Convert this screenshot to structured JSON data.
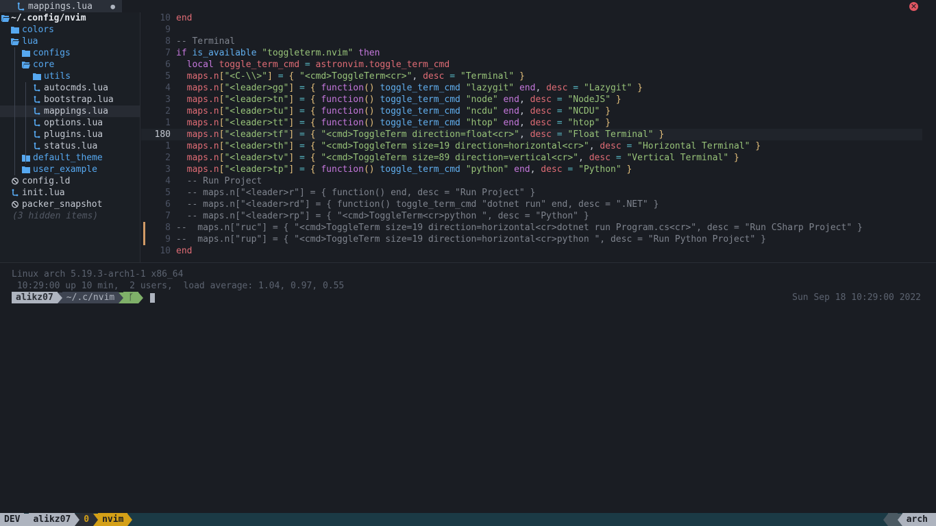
{
  "tabbar": {
    "active_tab": "mappings.lua",
    "modified_indicator": "●",
    "close_glyph": "✕",
    "close_color": "#e05561"
  },
  "tree": {
    "root": "~/.config/nvim",
    "items": [
      {
        "label": "colors",
        "type": "dir",
        "icon": "folder-icon"
      },
      {
        "label": "lua",
        "type": "dir",
        "icon": "folder-open-icon"
      },
      {
        "label": "configs",
        "type": "dir",
        "icon": "folder-icon"
      },
      {
        "label": "core",
        "type": "dir",
        "icon": "folder-open-icon"
      },
      {
        "label": "utils",
        "type": "dir",
        "icon": "folder-icon"
      },
      {
        "label": "autocmds.lua",
        "type": "file",
        "icon": "lua-file-icon"
      },
      {
        "label": "bootstrap.lua",
        "type": "file",
        "icon": "lua-file-icon"
      },
      {
        "label": "mappings.lua",
        "type": "file",
        "icon": "lua-file-icon",
        "selected": true
      },
      {
        "label": "options.lua",
        "type": "file",
        "icon": "lua-file-icon"
      },
      {
        "label": "plugins.lua",
        "type": "file",
        "icon": "lua-file-icon"
      },
      {
        "label": "status.lua",
        "type": "file",
        "icon": "lua-file-icon"
      },
      {
        "label": "default_theme",
        "type": "dir",
        "icon": "folder-icon"
      },
      {
        "label": "user_example",
        "type": "dir",
        "icon": "folder-icon"
      },
      {
        "label": "config.ld",
        "type": "file",
        "icon": "blocked-file-icon"
      },
      {
        "label": "init.lua",
        "type": "file",
        "icon": "lua-file-icon"
      },
      {
        "label": "packer_snapshot",
        "type": "file",
        "icon": "blocked-file-icon"
      }
    ],
    "hidden_items": "(3 hidden items)"
  },
  "editor": {
    "lines": [
      {
        "n": "10",
        "segs": [
          [
            "kw2",
            "end"
          ]
        ]
      },
      {
        "n": "9",
        "segs": []
      },
      {
        "n": "8",
        "segs": [
          [
            "cm",
            "-- Terminal"
          ]
        ]
      },
      {
        "n": "7",
        "segs": [
          [
            "kw",
            "if "
          ],
          [
            "fn",
            "is_available "
          ],
          [
            "str",
            "\"toggleterm.nvim\""
          ],
          [
            "kw",
            " then"
          ]
        ]
      },
      {
        "n": "6",
        "segs": [
          [
            "pl",
            "  "
          ],
          [
            "kw",
            "local "
          ],
          [
            "var",
            "toggle_term_cmd "
          ],
          [
            "op",
            "= "
          ],
          [
            "var",
            "astronvim.toggle_term_cmd"
          ]
        ]
      },
      {
        "n": "5",
        "segs": [
          [
            "pl",
            "  "
          ],
          [
            "var",
            "maps.n"
          ],
          [
            "br",
            "["
          ],
          [
            "str",
            "\"<C-\\\\>\""
          ],
          [
            "br",
            "]"
          ],
          [
            "op",
            " = "
          ],
          [
            "br",
            "{ "
          ],
          [
            "str",
            "\"<cmd>ToggleTerm<cr>\""
          ],
          [
            "pl",
            ", "
          ],
          [
            "var",
            "desc "
          ],
          [
            "op",
            "= "
          ],
          [
            "str",
            "\"Terminal\""
          ],
          [
            "br",
            " }"
          ]
        ]
      },
      {
        "n": "4",
        "segs": [
          [
            "pl",
            "  "
          ],
          [
            "var",
            "maps.n"
          ],
          [
            "br",
            "["
          ],
          [
            "str",
            "\"<leader>gg\""
          ],
          [
            "br",
            "]"
          ],
          [
            "op",
            " = "
          ],
          [
            "br",
            "{ "
          ],
          [
            "kw",
            "function"
          ],
          [
            "br",
            "()"
          ],
          [
            "fn",
            " toggle_term_cmd "
          ],
          [
            "str",
            "\"lazygit\""
          ],
          [
            "kw",
            " end"
          ],
          [
            "pl",
            ", "
          ],
          [
            "var",
            "desc "
          ],
          [
            "op",
            "= "
          ],
          [
            "str",
            "\"Lazygit\""
          ],
          [
            "br",
            " }"
          ]
        ]
      },
      {
        "n": "3",
        "segs": [
          [
            "pl",
            "  "
          ],
          [
            "var",
            "maps.n"
          ],
          [
            "br",
            "["
          ],
          [
            "str",
            "\"<leader>tn\""
          ],
          [
            "br",
            "]"
          ],
          [
            "op",
            " = "
          ],
          [
            "br",
            "{ "
          ],
          [
            "kw",
            "function"
          ],
          [
            "br",
            "()"
          ],
          [
            "fn",
            " toggle_term_cmd "
          ],
          [
            "str",
            "\"node\""
          ],
          [
            "kw",
            " end"
          ],
          [
            "pl",
            ", "
          ],
          [
            "var",
            "desc "
          ],
          [
            "op",
            "= "
          ],
          [
            "str",
            "\"NodeJS\""
          ],
          [
            "br",
            " }"
          ]
        ]
      },
      {
        "n": "2",
        "segs": [
          [
            "pl",
            "  "
          ],
          [
            "var",
            "maps.n"
          ],
          [
            "br",
            "["
          ],
          [
            "str",
            "\"<leader>tu\""
          ],
          [
            "br",
            "]"
          ],
          [
            "op",
            " = "
          ],
          [
            "br",
            "{ "
          ],
          [
            "kw",
            "function"
          ],
          [
            "br",
            "()"
          ],
          [
            "fn",
            " toggle_term_cmd "
          ],
          [
            "str",
            "\"ncdu\""
          ],
          [
            "kw",
            " end"
          ],
          [
            "pl",
            ", "
          ],
          [
            "var",
            "desc "
          ],
          [
            "op",
            "= "
          ],
          [
            "str",
            "\"NCDU\""
          ],
          [
            "br",
            " }"
          ]
        ]
      },
      {
        "n": "1",
        "segs": [
          [
            "pl",
            "  "
          ],
          [
            "var",
            "maps.n"
          ],
          [
            "br",
            "["
          ],
          [
            "str",
            "\"<leader>tt\""
          ],
          [
            "br",
            "]"
          ],
          [
            "op",
            " = "
          ],
          [
            "br",
            "{ "
          ],
          [
            "kw",
            "function"
          ],
          [
            "br",
            "()"
          ],
          [
            "fn",
            " toggle_term_cmd "
          ],
          [
            "str",
            "\"htop\""
          ],
          [
            "kw",
            " end"
          ],
          [
            "pl",
            ", "
          ],
          [
            "var",
            "desc "
          ],
          [
            "op",
            "= "
          ],
          [
            "str",
            "\"htop\""
          ],
          [
            "br",
            " }"
          ]
        ]
      },
      {
        "n": "180",
        "current": true,
        "segs": [
          [
            "pl",
            "  "
          ],
          [
            "var",
            "maps.n"
          ],
          [
            "br",
            "["
          ],
          [
            "str",
            "\"<leader>tf\""
          ],
          [
            "br",
            "]"
          ],
          [
            "op",
            " = "
          ],
          [
            "br",
            "{ "
          ],
          [
            "str",
            "\"<cmd>ToggleTerm direction=float<cr>\""
          ],
          [
            "pl",
            ", "
          ],
          [
            "var",
            "desc "
          ],
          [
            "op",
            "= "
          ],
          [
            "str",
            "\"Float Terminal\""
          ],
          [
            "br",
            " }"
          ]
        ]
      },
      {
        "n": "1",
        "segs": [
          [
            "pl",
            "  "
          ],
          [
            "var",
            "maps.n"
          ],
          [
            "br",
            "["
          ],
          [
            "str",
            "\"<leader>th\""
          ],
          [
            "br",
            "]"
          ],
          [
            "op",
            " = "
          ],
          [
            "br",
            "{ "
          ],
          [
            "str",
            "\"<cmd>ToggleTerm size=19 direction=horizontal<cr>\""
          ],
          [
            "pl",
            ", "
          ],
          [
            "var",
            "desc "
          ],
          [
            "op",
            "= "
          ],
          [
            "str",
            "\"Horizontal Terminal\""
          ],
          [
            "br",
            " }"
          ]
        ]
      },
      {
        "n": "2",
        "segs": [
          [
            "pl",
            "  "
          ],
          [
            "var",
            "maps.n"
          ],
          [
            "br",
            "["
          ],
          [
            "str",
            "\"<leader>tv\""
          ],
          [
            "br",
            "]"
          ],
          [
            "op",
            " = "
          ],
          [
            "br",
            "{ "
          ],
          [
            "str",
            "\"<cmd>ToggleTerm size=89 direction=vertical<cr>\""
          ],
          [
            "pl",
            ", "
          ],
          [
            "var",
            "desc "
          ],
          [
            "op",
            "= "
          ],
          [
            "str",
            "\"Vertical Terminal\""
          ],
          [
            "br",
            " }"
          ]
        ]
      },
      {
        "n": "3",
        "segs": [
          [
            "pl",
            "  "
          ],
          [
            "var",
            "maps.n"
          ],
          [
            "br",
            "["
          ],
          [
            "str",
            "\"<leader>tp\""
          ],
          [
            "br",
            "]"
          ],
          [
            "op",
            " = "
          ],
          [
            "br",
            "{ "
          ],
          [
            "kw",
            "function"
          ],
          [
            "br",
            "()"
          ],
          [
            "fn",
            " toggle_term_cmd "
          ],
          [
            "str",
            "\"python\""
          ],
          [
            "kw",
            " end"
          ],
          [
            "pl",
            ", "
          ],
          [
            "var",
            "desc "
          ],
          [
            "op",
            "= "
          ],
          [
            "str",
            "\"Python\""
          ],
          [
            "br",
            " }"
          ]
        ]
      },
      {
        "n": "4",
        "segs": [
          [
            "cm",
            "  -- Run Project"
          ]
        ]
      },
      {
        "n": "5",
        "segs": [
          [
            "cm",
            "  -- maps.n[\"<leader>r\"] = { function() end, desc = \"Run Project\" }"
          ]
        ]
      },
      {
        "n": "6",
        "segs": [
          [
            "cm",
            "  -- maps.n[\"<leader>rd\"] = { function() toggle_term_cmd \"dotnet run\" end, desc = \".NET\" }"
          ]
        ]
      },
      {
        "n": "7",
        "segs": [
          [
            "cm",
            "  -- maps.n[\"<leader>rp\"] = { \"<cmd>ToggleTerm<cr>python \", desc = \"Python\" }"
          ]
        ]
      },
      {
        "n": "8",
        "mark": true,
        "segs": [
          [
            "cm",
            "--  maps.n[\"ruc\"] = { \"<cmd>ToggleTerm size=19 direction=horizontal<cr>dotnet run Program.cs<cr>\", desc = \"Run CSharp Project\" }"
          ]
        ]
      },
      {
        "n": "9",
        "mark": true,
        "segs": [
          [
            "cm",
            "--  maps.n[\"rup\"] = { \"<cmd>ToggleTerm size=19 direction=horizontal<cr>python \", desc = \"Run Python Project\" }"
          ]
        ]
      },
      {
        "n": "10",
        "segs": [
          [
            "kw2",
            "end"
          ]
        ]
      }
    ]
  },
  "terminal": {
    "line1": "Linux arch 5.19.3-arch1-1 x86_64",
    "line2": " 10:29:00 up 10 min,  2 users,  load average: 1.04, 0.97, 0.55",
    "prompt_user": "alikz07",
    "prompt_path": "~/.c/nvim",
    "prompt_git": "ᚴ",
    "date": "Sun Sep 18 10:29:00 2022"
  },
  "statusbar": {
    "session": "DEV",
    "user": "alikz07",
    "window_index": "0",
    "window_name": "nvim",
    "hostname": "arch"
  }
}
